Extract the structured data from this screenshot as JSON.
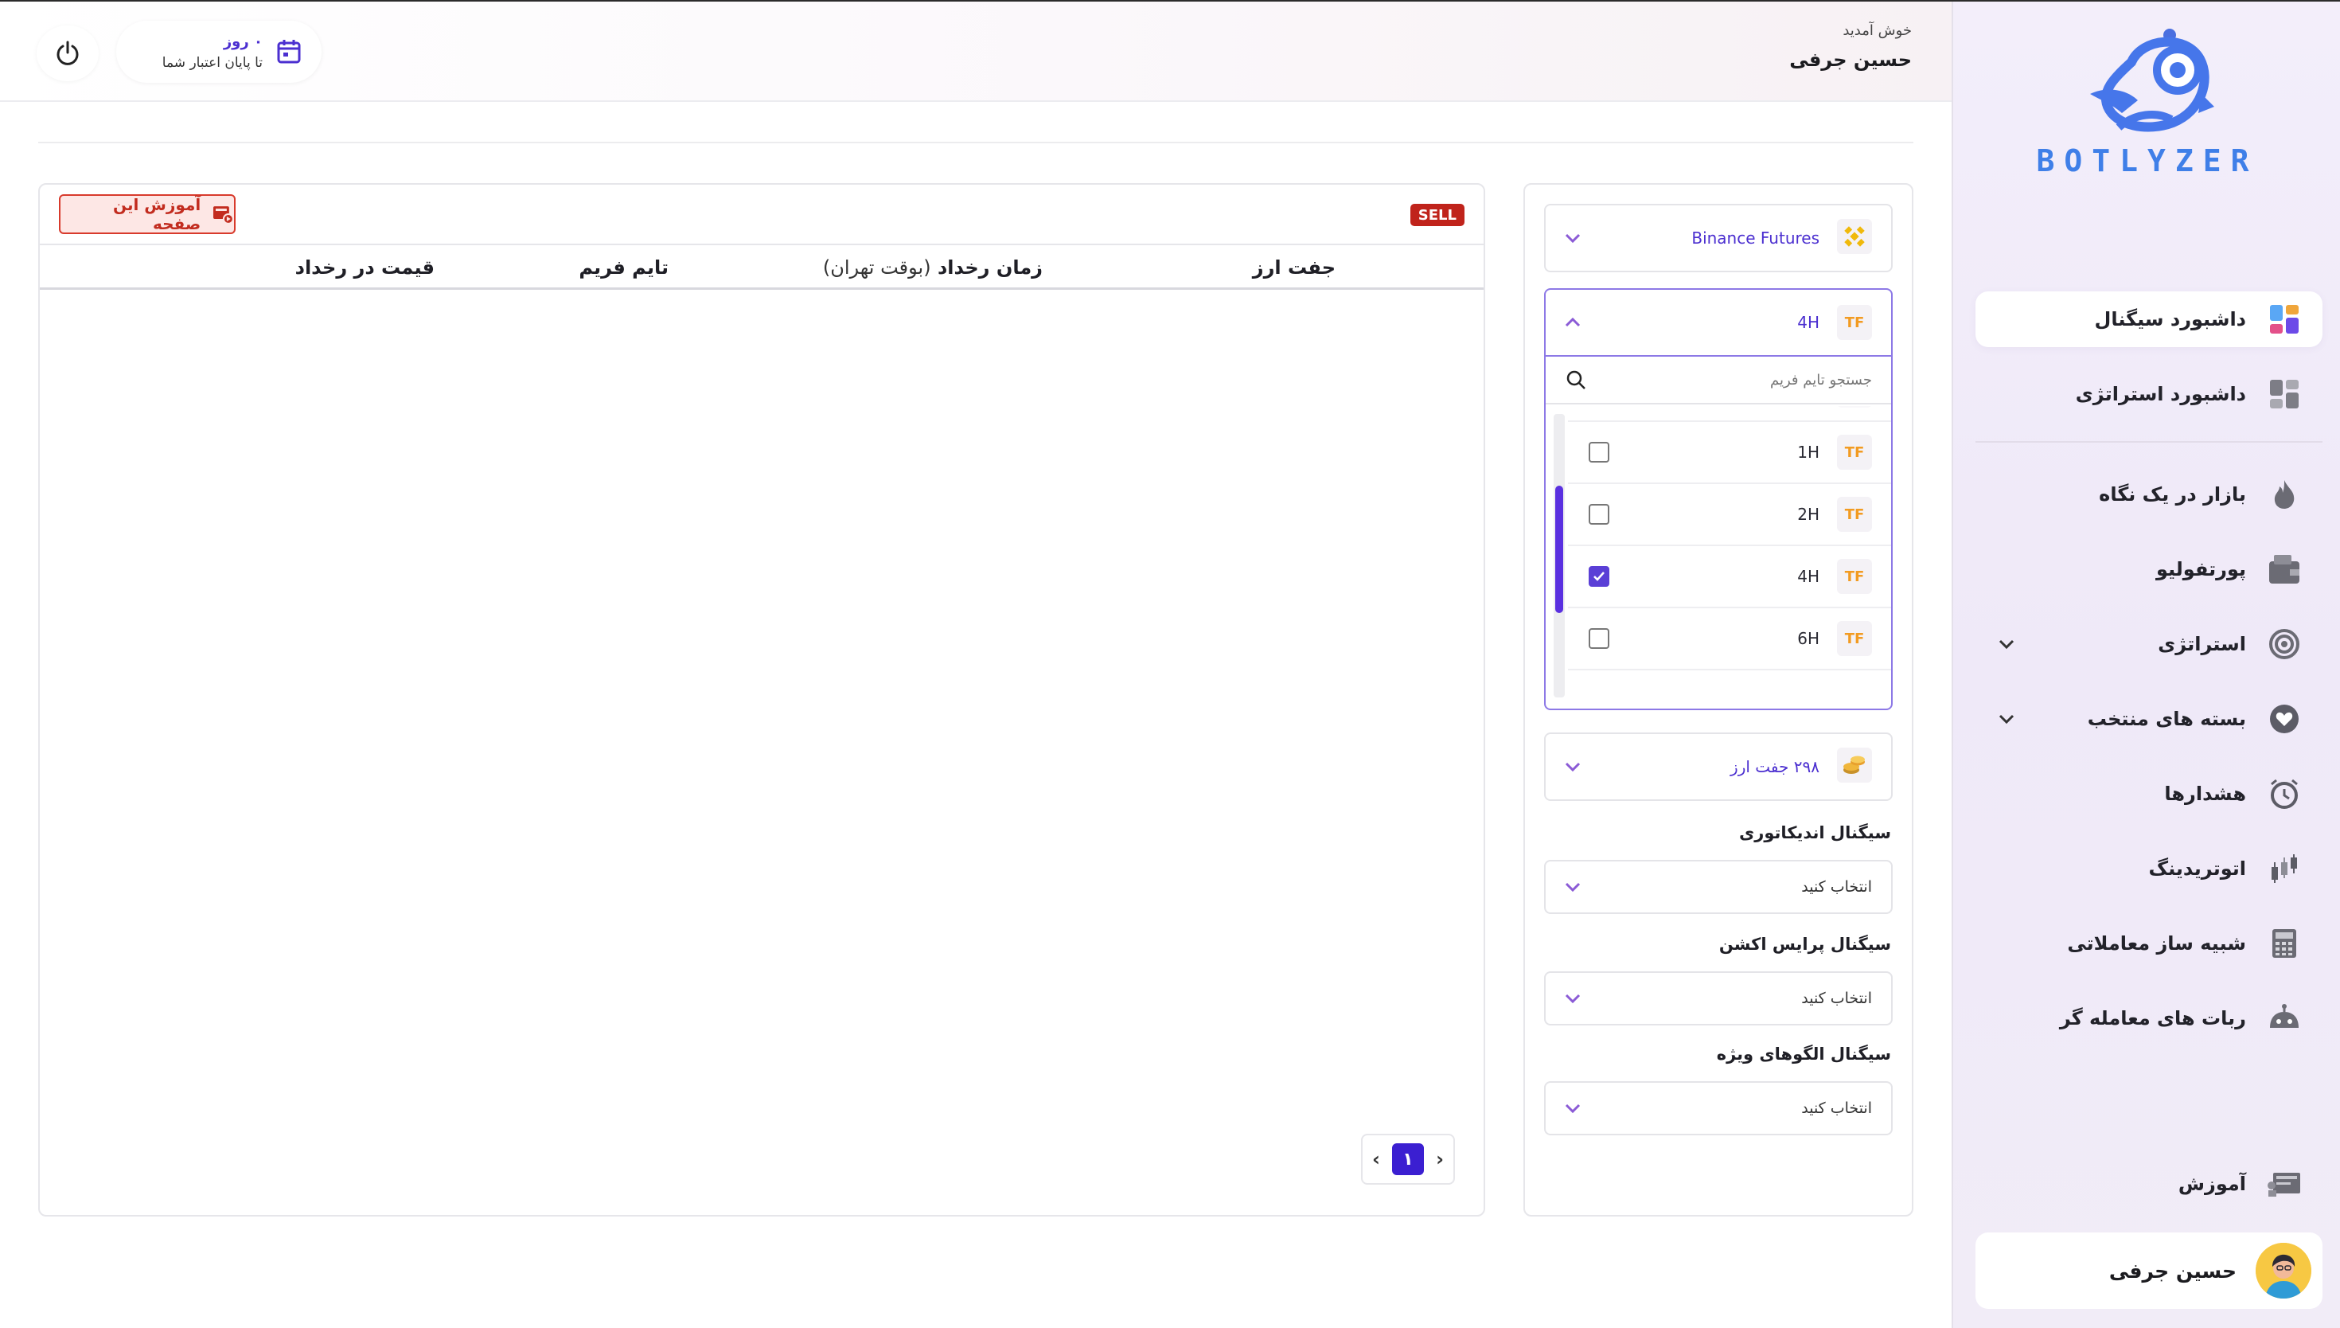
{
  "brand": {
    "name": "BOTLYZER"
  },
  "header": {
    "welcome": "خوش آمدید",
    "user_name": "حسین جرفی",
    "credit_days": "۰ روز",
    "credit_label": "تا پایان اعتبار شما"
  },
  "sidebar": {
    "items": [
      {
        "label": "داشبورد سیگنال",
        "icon": "signal-dashboard-icon",
        "active": true
      },
      {
        "label": "داشبورد استراتژی",
        "icon": "strategy-dashboard-icon"
      },
      {
        "label": "بازار در یک نگاه",
        "icon": "fire-icon"
      },
      {
        "label": "پورتفولیو",
        "icon": "wallet-icon"
      },
      {
        "label": "استراتژی",
        "icon": "target-icon"
      },
      {
        "label": "بسته های منتخب",
        "icon": "heart-icon"
      },
      {
        "label": "هشدارها",
        "icon": "alarm-clock-icon"
      },
      {
        "label": "اتوتریدینگ",
        "icon": "candles-icon"
      },
      {
        "label": "شبیه ساز معاملاتی",
        "icon": "calculator-icon"
      },
      {
        "label": "ربات های معامله گر",
        "icon": "robot-icon"
      }
    ],
    "bottom": {
      "label": "آموزش",
      "icon": "training-icon"
    },
    "profile_name": "حسین جرفی"
  },
  "table": {
    "tutorial_button": "آموزش این صفحه",
    "sell_badge": "SELL",
    "columns": {
      "pair": "جفت ارز",
      "time_main": "زمان رخداد",
      "time_note": "(بوقت تهران)",
      "timeframe": "تایم فریم",
      "price": "قیمت در رخداد"
    },
    "rows": [],
    "pagination": {
      "current_page": "۱"
    }
  },
  "filters": {
    "exchange": "Binance Futures",
    "timeframe": {
      "badge": "TF",
      "selected": "4H",
      "search_placeholder": "جستجو تایم فریم",
      "options": [
        {
          "label": "1H",
          "checked": false
        },
        {
          "label": "2H",
          "checked": false
        },
        {
          "label": "4H",
          "checked": true
        },
        {
          "label": "6H",
          "checked": false
        }
      ]
    },
    "pairs_label": "۲۹۸ جفت ارز",
    "indicator_label": "سیگنال اندیکاتوری",
    "price_action_label": "سیگنال پرایس اکشن",
    "patterns_label": "سیگنال الگوهای ویژه",
    "select_placeholder": "انتخاب کنید"
  },
  "colors": {
    "accent": "#4b2fd0",
    "sell": "#c0231b",
    "tf_badge": "#f29b21",
    "logo": "#3f7fe8"
  }
}
